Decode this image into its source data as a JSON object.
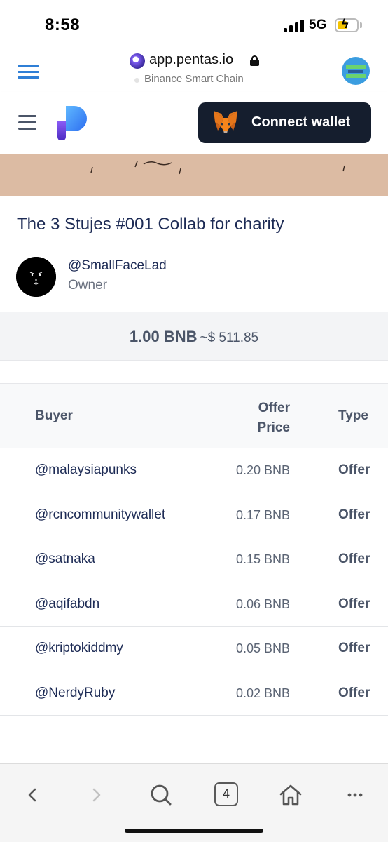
{
  "status_bar": {
    "time": "8:58",
    "network": "5G",
    "battery_icon": "battery-charging-icon",
    "signal_icon": "signal-bars-icon"
  },
  "browser": {
    "url": "app.pentas.io",
    "network_label": "Binance Smart Chain",
    "menu_icon": "hamburger-menu-icon",
    "lock_icon": "lock-icon",
    "accent_color": "#2f7fd6"
  },
  "navbar": {
    "menu_icon": "hamburger-menu-icon",
    "logo_icon": "pentas-logo-icon",
    "connect_wallet_label": "Connect wallet",
    "wallet_icon": "metamask-fox-icon",
    "button_color": "#151e2e"
  },
  "nft": {
    "title": "The 3 Stujes #001 Collab for charity",
    "owner_handle": "@SmallFaceLad",
    "owner_role": "Owner",
    "price": "1.00 BNB",
    "price_usd": "~$ 511.85"
  },
  "offers": {
    "headers": {
      "buyer": "Buyer",
      "price_line1": "Offer",
      "price_line2": "Price",
      "type": "Type"
    },
    "rows": [
      {
        "buyer": "@malaysiapunks",
        "price": "0.20 BNB",
        "type": "Offer"
      },
      {
        "buyer": "@rcncommunitywallet",
        "price": "0.17 BNB",
        "type": "Offer"
      },
      {
        "buyer": "@satnaka",
        "price": "0.15 BNB",
        "type": "Offer"
      },
      {
        "buyer": "@aqifabdn",
        "price": "0.06 BNB",
        "type": "Offer"
      },
      {
        "buyer": "@kriptokiddmy",
        "price": "0.05 BNB",
        "type": "Offer"
      },
      {
        "buyer": "@NerdyRuby",
        "price": "0.02 BNB",
        "type": "Offer"
      }
    ]
  },
  "bottom_bar": {
    "tab_count": "4",
    "icons": [
      "back-icon",
      "forward-icon",
      "search-icon",
      "tabs-icon",
      "home-icon",
      "more-icon"
    ]
  }
}
